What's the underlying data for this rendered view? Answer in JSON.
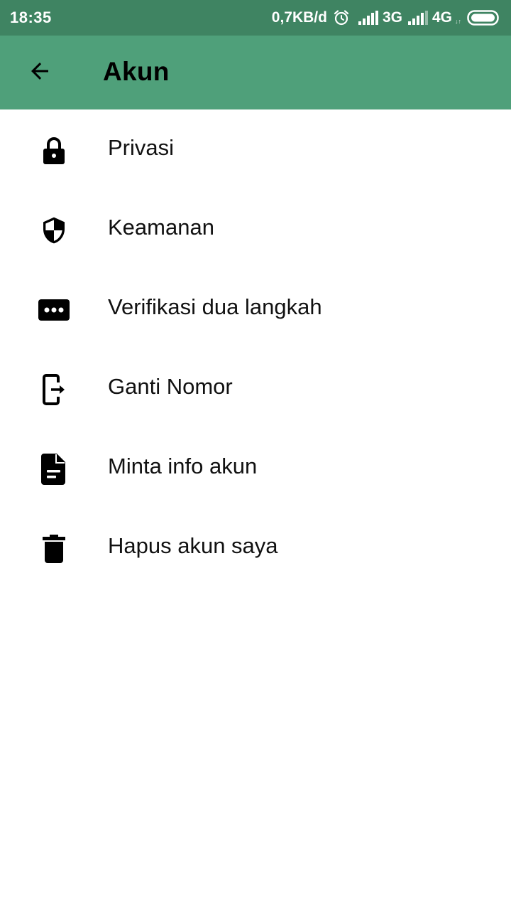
{
  "status_bar": {
    "time": "18:35",
    "data_speed": "0,7KB/d",
    "network_1": "3G",
    "network_2": "4G",
    "network_2_sub": "↓↑",
    "alarm_icon": "alarm-clock-icon",
    "signal_icon": "signal-bars-icon",
    "battery_icon": "battery-icon",
    "background_color": "#3f8462"
  },
  "toolbar": {
    "title": "Akun",
    "back_icon": "arrow-back-icon",
    "background_color": "#4fa07a"
  },
  "menu": {
    "items": [
      {
        "label": "Privasi",
        "icon": "lock-icon"
      },
      {
        "label": "Keamanan",
        "icon": "shield-icon"
      },
      {
        "label": "Verifikasi dua langkah",
        "icon": "password-dots-icon"
      },
      {
        "label": "Ganti Nomor",
        "icon": "change-number-icon"
      },
      {
        "label": "Minta info akun",
        "icon": "document-icon"
      },
      {
        "label": "Hapus akun saya",
        "icon": "trash-icon"
      }
    ]
  }
}
